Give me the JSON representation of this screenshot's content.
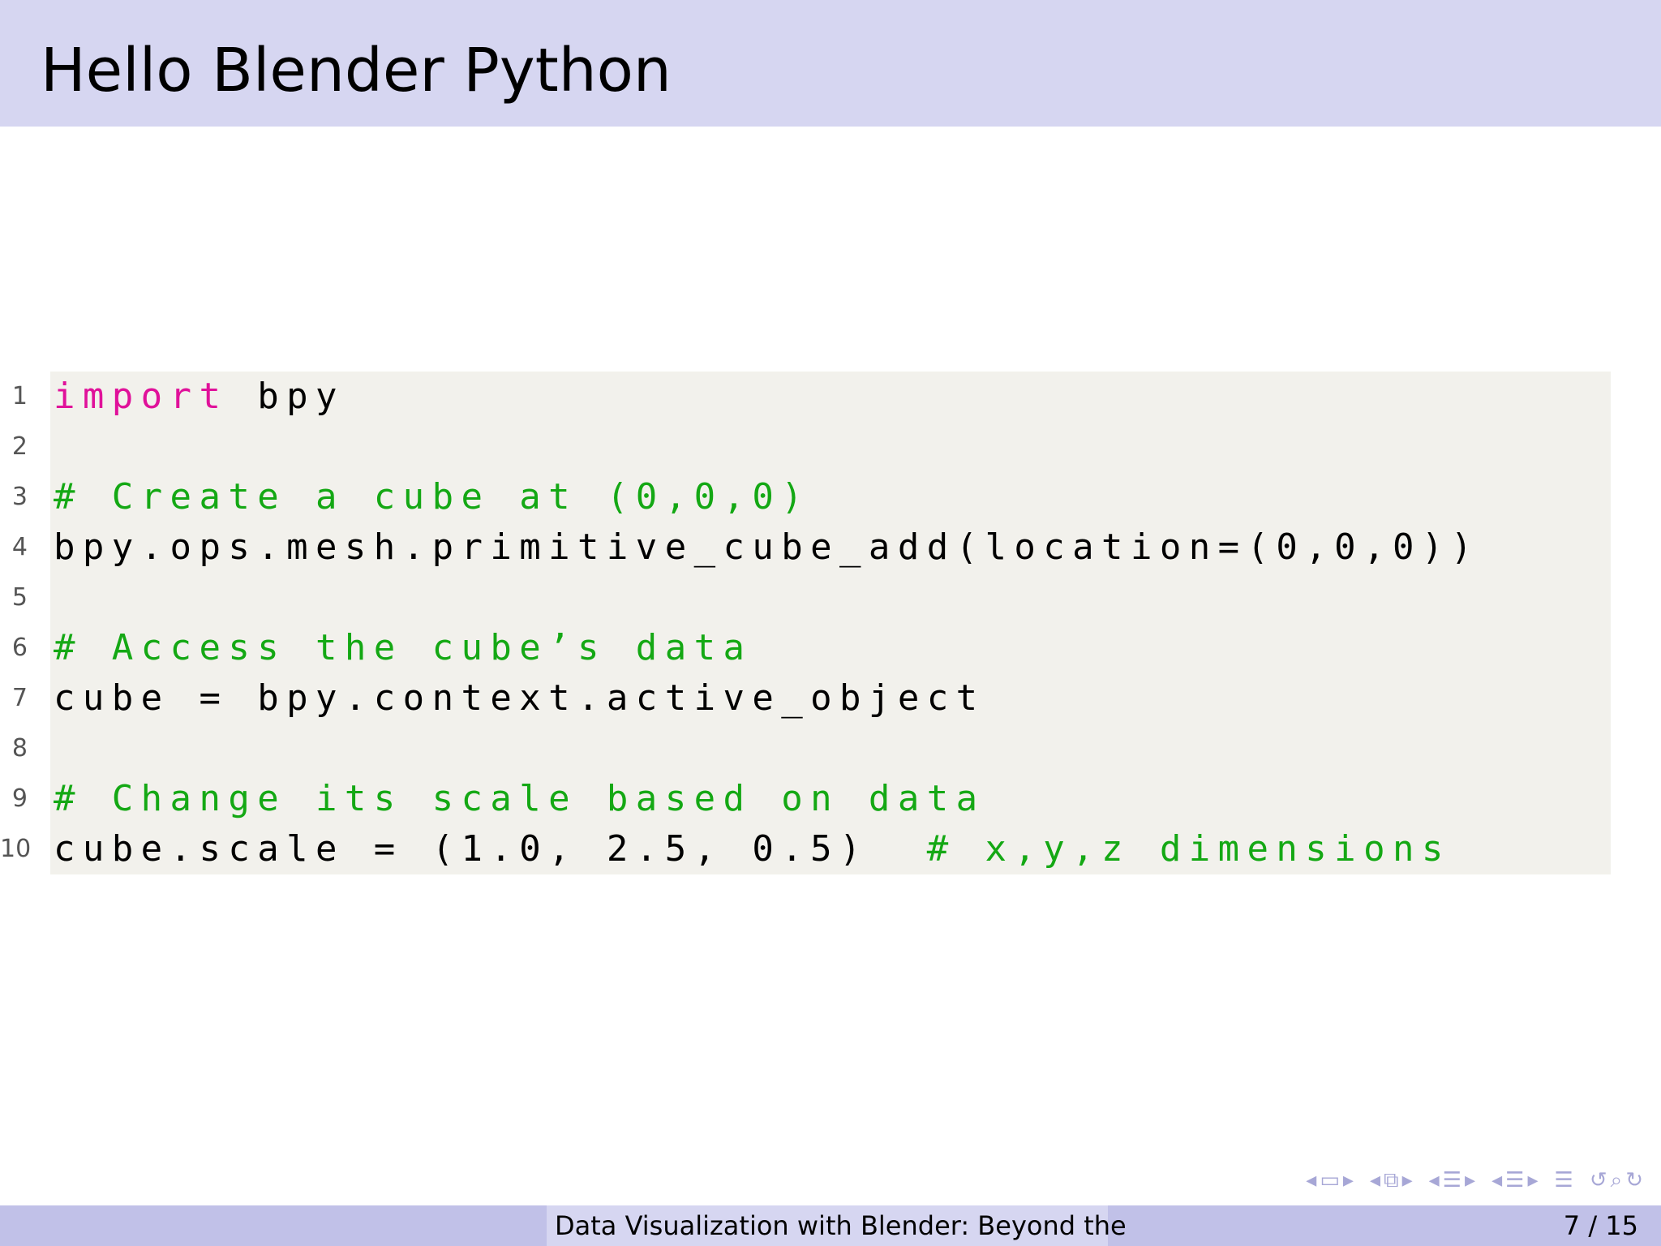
{
  "slide": {
    "title": "Hello Blender Python",
    "footer_title": "Data Visualization with Blender: Beyond the",
    "page_indicator": "7 / 15"
  },
  "code": {
    "lines": [
      {
        "number": "1",
        "segments": [
          {
            "text": "import",
            "type": "keyword"
          },
          {
            "text": " bpy",
            "type": "plain"
          }
        ]
      },
      {
        "number": "2",
        "segments": []
      },
      {
        "number": "3",
        "segments": [
          {
            "text": "# Create a cube at (0,0,0)",
            "type": "comment"
          }
        ]
      },
      {
        "number": "4",
        "segments": [
          {
            "text": "bpy.ops.mesh.primitive_cube_add(location=(0,0,0))",
            "type": "plain"
          }
        ]
      },
      {
        "number": "5",
        "segments": []
      },
      {
        "number": "6",
        "segments": [
          {
            "text": "# Access the cube’s data",
            "type": "comment"
          }
        ]
      },
      {
        "number": "7",
        "segments": [
          {
            "text": "cube = bpy.context.active_object",
            "type": "plain"
          }
        ]
      },
      {
        "number": "8",
        "segments": []
      },
      {
        "number": "9",
        "segments": [
          {
            "text": "# Change its scale based on data",
            "type": "comment"
          }
        ]
      },
      {
        "number": "10",
        "segments": [
          {
            "text": "cube.scale = (1.0, 2.5, 0.5)  ",
            "type": "plain"
          },
          {
            "text": "# x,y,z dimensions",
            "type": "comment"
          }
        ]
      }
    ]
  },
  "colors": {
    "title_bar": "#d6d6f1",
    "footer_bar": "#c1c1e8",
    "code_background": "#f2f1ec",
    "keyword": "#e0119a",
    "comment": "#14a814",
    "nav_icons": "#a7a7d6"
  },
  "navigation": {
    "icons": [
      "nav-prev-slide-icon",
      "nav-slide-icon",
      "nav-next-slide-icon",
      "nav-prev-frame-icon",
      "nav-frame-icon",
      "nav-next-frame-icon",
      "nav-prev-subsection-icon",
      "nav-subsection-icon",
      "nav-next-subsection-icon",
      "nav-prev-section-icon",
      "nav-section-icon",
      "nav-next-section-icon",
      "nav-toc-icon",
      "undo-icon",
      "search-icon",
      "redo-icon"
    ]
  }
}
